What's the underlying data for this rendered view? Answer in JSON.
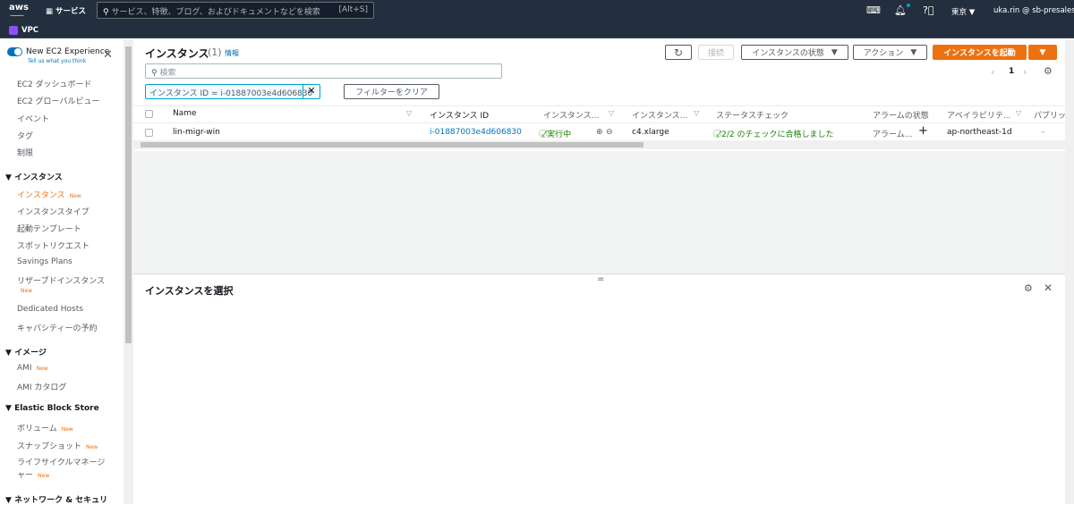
{
  "topnav": {
    "logo": "aws",
    "services": "サービス",
    "search_placeholder": "サービス、特徴、ブログ、およびドキュメントなどを検索",
    "search_shortcut": "[Alt+S]",
    "region": "東京 ▼",
    "account": "uka.rin @ sb-presales ▼"
  },
  "subnav": {
    "service": "VPC"
  },
  "sidebar": {
    "toggle_label": "New EC2 Experience",
    "feedback": "Tell us what you think",
    "items_top": [
      "EC2 ダッシュボード",
      "EC2 グローバルビュー",
      "イベント",
      "タグ",
      "制限"
    ],
    "sections": [
      {
        "title": "インスタンス",
        "items": [
          {
            "label": "インスタンス",
            "badge": "New",
            "active": true
          },
          {
            "label": "インスタンスタイプ"
          },
          {
            "label": "起動テンプレート"
          },
          {
            "label": "スポットリクエスト"
          },
          {
            "label": "Savings Plans"
          },
          {
            "label": "リザーブドインスタンス",
            "badge": "New"
          },
          {
            "label": "Dedicated Hosts"
          },
          {
            "label": "キャパシティーの予約"
          }
        ]
      },
      {
        "title": "イメージ",
        "items": [
          {
            "label": "AMI",
            "badge": "New"
          },
          {
            "label": "AMI カタログ"
          }
        ]
      },
      {
        "title": "Elastic Block Store",
        "items": [
          {
            "label": "ボリューム",
            "badge": "New"
          },
          {
            "label": "スナップショット",
            "badge": "New"
          },
          {
            "label": "ライフサイクルマネージャー",
            "badge": "New"
          }
        ]
      },
      {
        "title": "ネットワーク & セキュリ",
        "items": []
      }
    ]
  },
  "main": {
    "title": "インスタンス",
    "count": "(1)",
    "info": "情報",
    "connect": "接続",
    "instance_state": "インスタンスの状態",
    "actions": "アクション",
    "launch": "インスタンスを起動",
    "search_placeholder": "検索",
    "filter_token": "インスタンス ID = i-01887003e4d606830",
    "clear_filters": "フィルターをクリア",
    "page": "1",
    "columns": [
      "Name",
      "インスタンス ID",
      "インスタンス...",
      "インスタンス...",
      "ステータスチェック",
      "アラームの状態",
      "アベイラビリテ...",
      "パブリッ"
    ],
    "rows": [
      {
        "name": "lin-migr-win",
        "id": "i-01887003e4d606830",
        "state": "実行中",
        "type": "c4.xlarge",
        "status": "2/2 のチェックに合格しました",
        "alarm": "アラーム...",
        "az": "ap-northeast-1d",
        "public": "–"
      }
    ]
  },
  "bottom": {
    "title": "インスタンスを選択"
  },
  "colors": {
    "nav": "#232f3e",
    "accent": "#ec7211",
    "link": "#0073bb",
    "ok": "#1d8102"
  }
}
